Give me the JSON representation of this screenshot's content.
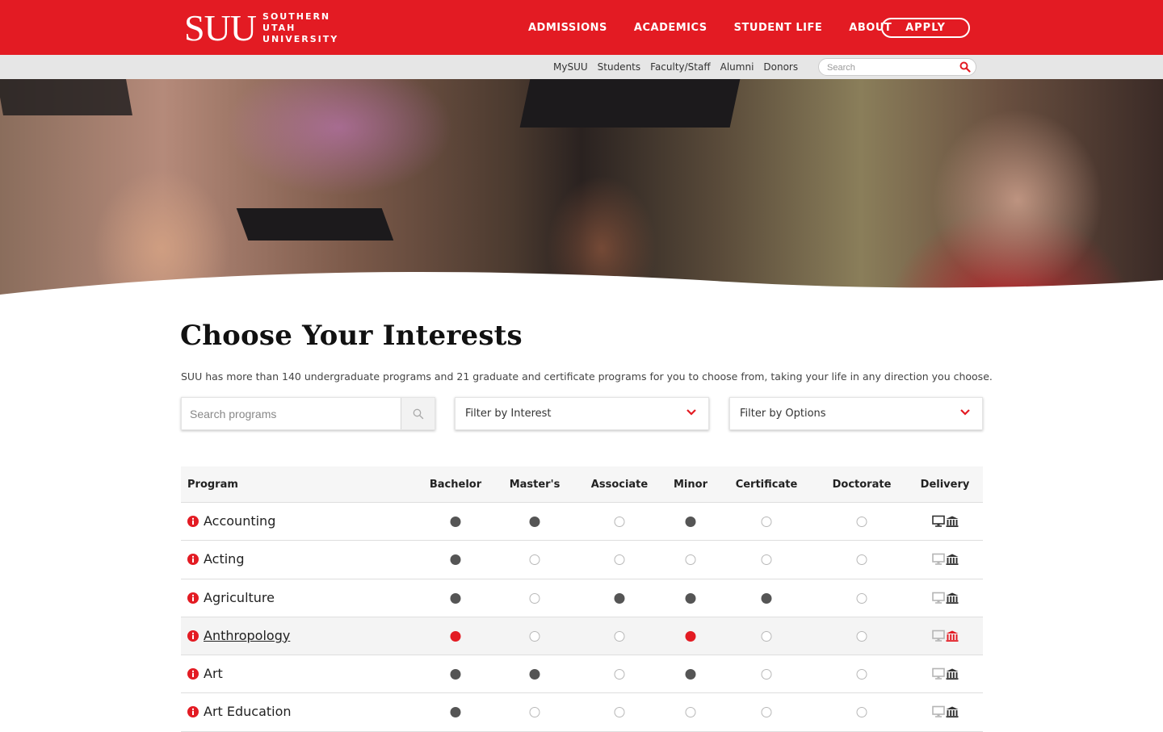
{
  "brand": {
    "mark": "SUU",
    "line1": "SOUTHERN",
    "line2": "UTAH",
    "line3": "UNIVERSITY",
    "accent": "#e31b23"
  },
  "main_nav": [
    "ADMISSIONS",
    "ACADEMICS",
    "STUDENT LIFE",
    "ABOUT"
  ],
  "apply_label": "APPLY",
  "sub_nav": [
    "MySUU",
    "Students",
    "Faculty/Staff",
    "Alumni",
    "Donors"
  ],
  "top_search": {
    "placeholder": "Search",
    "value": ""
  },
  "page": {
    "title": "Choose Your Interests",
    "intro": "SUU has more than 140 undergraduate programs and 21 graduate and certificate programs for you to choose from, taking your life in any direction you choose."
  },
  "program_search": {
    "placeholder": "Search programs",
    "value": ""
  },
  "filters": {
    "interest": "Filter by Interest",
    "options": "Filter by Options"
  },
  "table": {
    "headers": [
      "Program",
      "Bachelor",
      "Master's",
      "Associate",
      "Minor",
      "Certificate",
      "Doctorate",
      "Delivery"
    ],
    "rows": [
      {
        "name": "Accounting",
        "offered": [
          true,
          true,
          false,
          true,
          false,
          false
        ],
        "online": true,
        "campus": true,
        "highlight": false
      },
      {
        "name": "Acting",
        "offered": [
          true,
          false,
          false,
          false,
          false,
          false
        ],
        "online": false,
        "campus": true,
        "highlight": false
      },
      {
        "name": "Agriculture",
        "offered": [
          true,
          false,
          true,
          true,
          true,
          false
        ],
        "online": false,
        "campus": true,
        "highlight": false
      },
      {
        "name": "Anthropology",
        "offered": [
          true,
          false,
          false,
          true,
          false,
          false
        ],
        "online": false,
        "campus": true,
        "highlight": true
      },
      {
        "name": "Art",
        "offered": [
          true,
          true,
          false,
          true,
          false,
          false
        ],
        "online": false,
        "campus": true,
        "highlight": false
      },
      {
        "name": "Art Education",
        "offered": [
          true,
          false,
          false,
          false,
          false,
          false
        ],
        "online": false,
        "campus": true,
        "highlight": false
      }
    ]
  }
}
